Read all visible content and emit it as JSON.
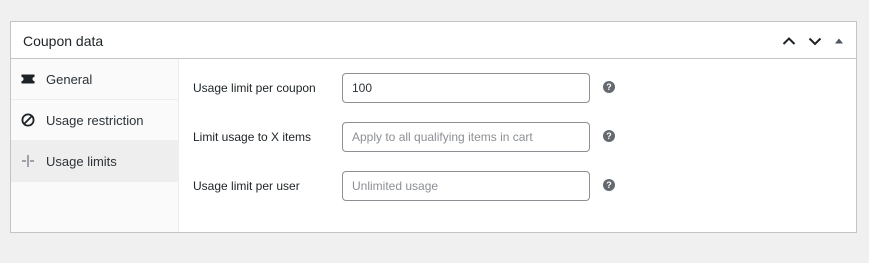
{
  "postbox": {
    "title": "Coupon data",
    "actions": [
      {
        "icon": "chevron-up-icon",
        "label": "Move up"
      },
      {
        "icon": "chevron-down-icon",
        "label": "Move down"
      },
      {
        "icon": "caret-up-icon",
        "label": "Toggle panel"
      }
    ]
  },
  "tabs": [
    {
      "label": "General",
      "icon": "ticket-icon",
      "active": false
    },
    {
      "label": "Usage restriction",
      "icon": "prohibited-icon",
      "active": false
    },
    {
      "label": "Usage limits",
      "icon": "limits-icon",
      "active": true
    }
  ],
  "fields": [
    {
      "label": "Usage limit per coupon",
      "value": "100",
      "placeholder": "",
      "help": "?"
    },
    {
      "label": "Limit usage to X items",
      "value": "",
      "placeholder": "Apply to all qualifying items in cart",
      "help": "?"
    },
    {
      "label": "Usage limit per user",
      "value": "",
      "placeholder": "Unlimited usage",
      "help": "?"
    }
  ],
  "colors": {
    "page_background": "#f0f0f1",
    "panel_border": "#c3c4c7",
    "active_tab": "#eeeeee",
    "help_icon": "#646970"
  }
}
